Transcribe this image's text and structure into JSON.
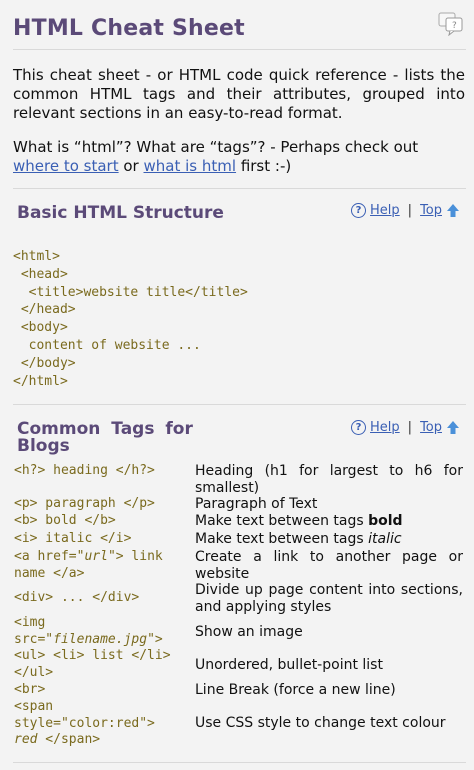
{
  "header": {
    "title": "HTML Cheat Sheet",
    "corner_icon": "comment-bubble-icon"
  },
  "intro": {
    "paragraph": "This cheat sheet - or HTML code quick reference - lists the common HTML tags and their attributes, grouped into relevant sections in an easy-to-read format.",
    "q_prefix": "What is “html”? What are “tags”? - Perhaps check out ",
    "link1": "where to start",
    "q_mid": " or ",
    "link2": "what is html",
    "q_suffix": " first :-)"
  },
  "nav": {
    "help": "Help",
    "separator": "|",
    "top": "Top"
  },
  "basic": {
    "title": "Basic HTML Structure",
    "code": [
      "<html>",
      " <head>",
      "  <title>website title</title>",
      " </head>",
      " <body>",
      "  content of website ...",
      " </body>",
      "</html>"
    ]
  },
  "blogs": {
    "title_line1": "Common Tags for",
    "title_line2": "Blogs",
    "rows": [
      {
        "code": [
          "<h?> heading </h?>"
        ],
        "desc": "Heading (h1 for largest to h6 for smallest)"
      },
      {
        "code": [
          "<p> paragraph </p>"
        ],
        "desc": "Paragraph of Text"
      },
      {
        "code": [
          "<b> bold </b>"
        ],
        "desc": "Make text between tags ",
        "desc_em": "bold"
      },
      {
        "code": [
          "<i> italic </i>"
        ],
        "desc": "Make text between tags ",
        "desc_em": "italic"
      },
      {
        "code_pre": "<a href=\"",
        "code_var": "url",
        "code_post": "\"> link name </a>",
        "desc": "Create a link to another page or website"
      },
      {
        "code": [
          "<div> ... </div>"
        ],
        "desc": "Divide up page content into sections, and applying styles"
      },
      {
        "code_pre": "<img src=\"",
        "code_var": "filename.jpg",
        "code_post": "\">",
        "desc": "Show an image"
      },
      {
        "code": [
          "<ul> <li> list </li> </ul>"
        ],
        "desc": "Unordered, bullet-point list"
      },
      {
        "code": [
          "<br>"
        ],
        "desc": "Line Break (force a new line)"
      },
      {
        "code_pre": "<span style=\"color:red\"> ",
        "code_var": "red",
        "code_post": " </span>",
        "desc": "Use CSS style to change text colour"
      }
    ]
  },
  "colors": {
    "heading": "#5b4a78",
    "link": "#3a5fb4",
    "code": "#7a6a1e"
  }
}
